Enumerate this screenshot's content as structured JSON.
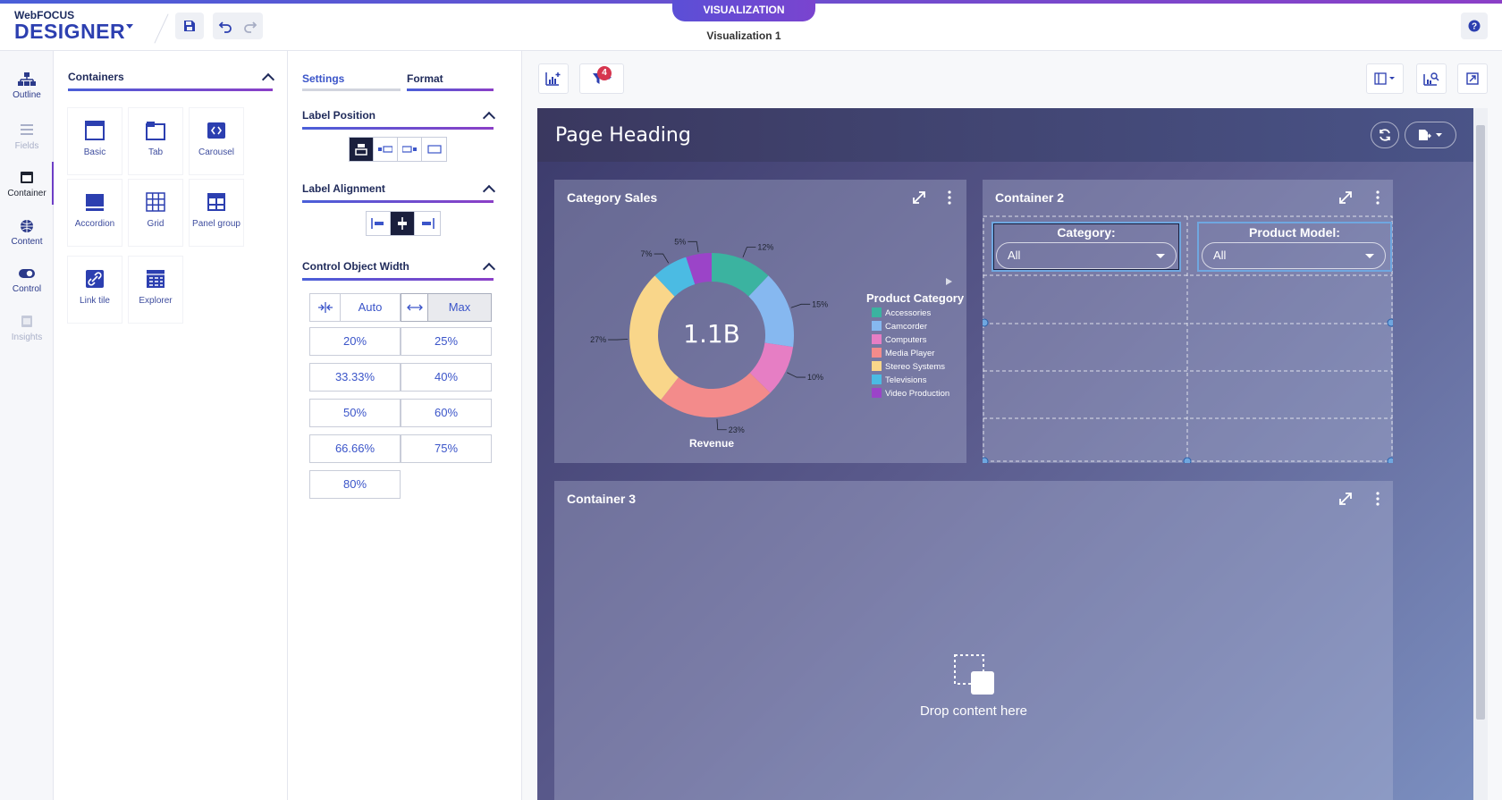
{
  "header": {
    "brand_small": "WebFOCUS",
    "brand_large": "DESIGNER",
    "mode_pill": "VISUALIZATION",
    "doc_title": "Visualization 1"
  },
  "rail": {
    "items": [
      {
        "label": "Outline",
        "icon": "outline-icon"
      },
      {
        "label": "Fields",
        "icon": "list-icon"
      },
      {
        "label": "Container",
        "icon": "container-icon"
      },
      {
        "label": "Content",
        "icon": "globe-icon"
      },
      {
        "label": "Control",
        "icon": "toggle-icon"
      },
      {
        "label": "Insights",
        "icon": "insights-icon"
      }
    ],
    "selected": "Container"
  },
  "containers_panel": {
    "title": "Containers",
    "tiles": [
      {
        "label": "Basic",
        "icon": "window-icon"
      },
      {
        "label": "Tab",
        "icon": "tab-icon"
      },
      {
        "label": "Carousel",
        "icon": "carousel-icon"
      },
      {
        "label": "Accordion",
        "icon": "accordion-icon"
      },
      {
        "label": "Grid",
        "icon": "grid-icon"
      },
      {
        "label": "Panel group",
        "icon": "panel-group-icon"
      },
      {
        "label": "Link tile",
        "icon": "link-icon"
      },
      {
        "label": "Explorer",
        "icon": "explorer-icon"
      }
    ]
  },
  "settings_panel": {
    "tabs": [
      "Settings",
      "Format"
    ],
    "active_tab": "Format",
    "label_position_title": "Label Position",
    "label_alignment_title": "Label Alignment",
    "control_width_title": "Control Object Width",
    "width_auto": "Auto",
    "width_max": "Max",
    "width_options": [
      "20%",
      "25%",
      "33.33%",
      "40%",
      "50%",
      "60%",
      "66.66%",
      "75%",
      "80%"
    ]
  },
  "canvas": {
    "filter_count": "4",
    "page_heading": "Page Heading",
    "panels": {
      "category_sales": "Category Sales",
      "container2": "Container 2",
      "container3": "Container 3"
    },
    "drop_text": "Drop content here",
    "filters": [
      {
        "label": "Category:",
        "value": "All"
      },
      {
        "label": "Product Model:",
        "value": "All"
      }
    ]
  },
  "chart_data": {
    "type": "pie",
    "center_label": "1.1B",
    "xlabel": "Revenue",
    "legend_title": "Product Category",
    "legend_position": "right",
    "categories": [
      "Accessories",
      "Camcorder",
      "Computers",
      "Media Player",
      "Stereo Systems",
      "Televisions",
      "Video Production"
    ],
    "values": [
      12,
      15,
      10,
      23,
      27,
      7,
      5
    ],
    "value_labels": [
      "12%",
      "15%",
      "10%",
      "23%",
      "27%",
      "7%",
      "5%"
    ],
    "colors": [
      "#3bb3a0",
      "#86b8f0",
      "#e67ec4",
      "#f38b8b",
      "#f9d68a",
      "#4bbbe3",
      "#9b44c8"
    ]
  }
}
